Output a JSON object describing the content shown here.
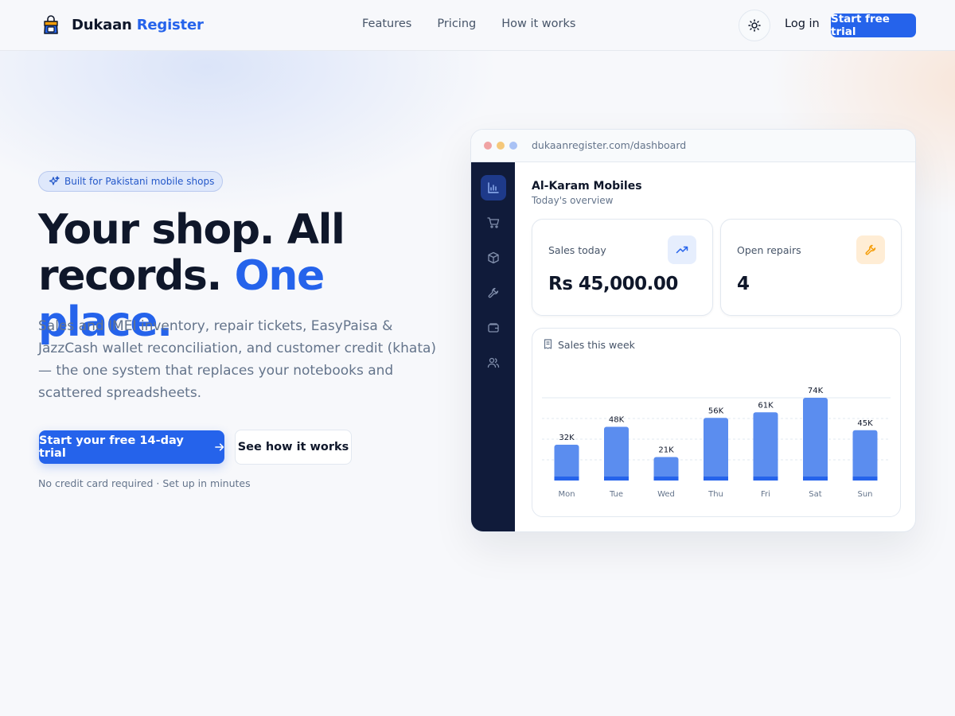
{
  "nav": {
    "brand_part1": "Dukaan",
    "brand_part2": "Register",
    "links": [
      "Features",
      "Pricing",
      "How it works"
    ],
    "login": "Log in",
    "trial": "Start free trial",
    "theme_icon": "sun-icon"
  },
  "hero": {
    "badge": "Built for Pakistani mobile shops",
    "headline_part1": "Your shop. All records.",
    "headline_accent": "One place.",
    "subtext": "Sales and IMEI inventory, repair tickets, EasyPaisa & JazzCash wallet reconciliation, and customer credit (khata) — the one system that replaces your notebooks and scattered spreadsheets.",
    "cta_primary": "Start your free 14-day trial",
    "cta_secondary": "See how it works",
    "fineprint": "No credit card required · Set up in minutes"
  },
  "dashboard": {
    "url": "dukaanregister.com/dashboard",
    "shop_name": "Al-Karam Mobiles",
    "shop_sub": "Today's overview",
    "sidebar_icons": [
      "chart-icon",
      "cart-icon",
      "box-icon",
      "wrench-icon",
      "wallet-icon",
      "users-icon"
    ],
    "cards": [
      {
        "label": "Sales today",
        "value": "Rs 45,000.00",
        "icon": "trending-up-icon"
      },
      {
        "label": "Open repairs",
        "value": "4",
        "icon": "wrench-icon"
      }
    ],
    "chart_title": "Sales this week"
  },
  "colors": {
    "accent": "#2563eb",
    "sidebar": "#101b3a",
    "bar": "#5b8def",
    "bar_base": "#2563eb",
    "repair_icon_bg": "#ffedd5",
    "repair_icon": "#f59e0b"
  },
  "chart_data": {
    "type": "bar",
    "title": "Sales this week",
    "categories": [
      "Mon",
      "Tue",
      "Wed",
      "Thu",
      "Fri",
      "Sat",
      "Sun"
    ],
    "values": [
      32000,
      48000,
      21000,
      56000,
      61000,
      74000,
      45000
    ],
    "data_labels": [
      "32K",
      "48K",
      "21K",
      "56K",
      "61K",
      "74K",
      "45K"
    ],
    "ylim": [
      0,
      74000
    ],
    "grid": true,
    "legend": "none"
  }
}
